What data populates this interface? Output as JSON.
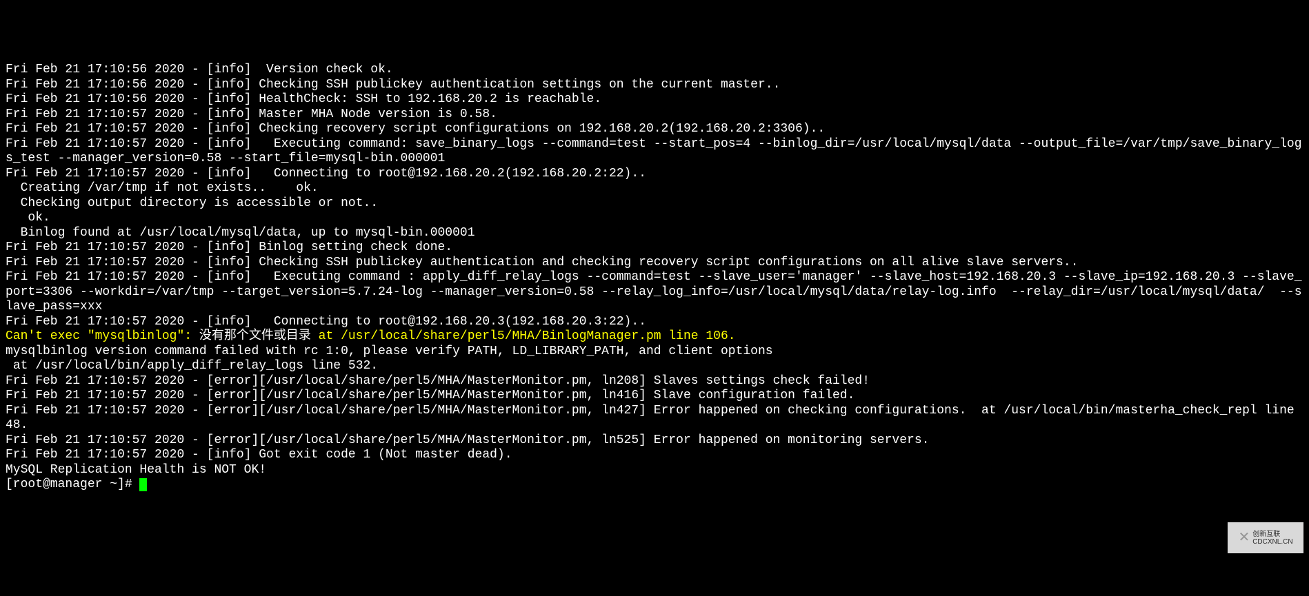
{
  "lines": [
    {
      "segments": [
        {
          "text": "Fri Feb 21 17:10:56 2020 - [info]  Version check ok."
        }
      ]
    },
    {
      "segments": [
        {
          "text": "Fri Feb 21 17:10:56 2020 - [info] Checking SSH publickey authentication settings on the current master.."
        }
      ]
    },
    {
      "segments": [
        {
          "text": "Fri Feb 21 17:10:56 2020 - [info] HealthCheck: SSH to 192.168.20.2 is reachable."
        }
      ]
    },
    {
      "segments": [
        {
          "text": "Fri Feb 21 17:10:57 2020 - [info] Master MHA Node version is 0.58."
        }
      ]
    },
    {
      "segments": [
        {
          "text": "Fri Feb 21 17:10:57 2020 - [info] Checking recovery script configurations on 192.168.20.2(192.168.20.2:3306).."
        }
      ]
    },
    {
      "segments": [
        {
          "text": "Fri Feb 21 17:10:57 2020 - [info]   Executing command: save_binary_logs --command=test --start_pos=4 --binlog_dir=/usr/local/mysql/data --output_file=/var/tmp/save_binary_logs_test --manager_version=0.58 --start_file=mysql-bin.000001"
        }
      ]
    },
    {
      "segments": [
        {
          "text": "Fri Feb 21 17:10:57 2020 - [info]   Connecting to root@192.168.20.2(192.168.20.2:22).."
        }
      ]
    },
    {
      "segments": [
        {
          "text": "  Creating /var/tmp if not exists..    ok."
        }
      ]
    },
    {
      "segments": [
        {
          "text": "  Checking output directory is accessible or not.."
        }
      ]
    },
    {
      "segments": [
        {
          "text": "   ok."
        }
      ]
    },
    {
      "segments": [
        {
          "text": "  Binlog found at /usr/local/mysql/data, up to mysql-bin.000001"
        }
      ]
    },
    {
      "segments": [
        {
          "text": "Fri Feb 21 17:10:57 2020 - [info] Binlog setting check done."
        }
      ]
    },
    {
      "segments": [
        {
          "text": "Fri Feb 21 17:10:57 2020 - [info] Checking SSH publickey authentication and checking recovery script configurations on all alive slave servers.."
        }
      ]
    },
    {
      "segments": [
        {
          "text": "Fri Feb 21 17:10:57 2020 - [info]   Executing command : apply_diff_relay_logs --command=test --slave_user='manager' --slave_host=192.168.20.3 --slave_ip=192.168.20.3 --slave_port=3306 --workdir=/var/tmp --target_version=5.7.24-log --manager_version=0.58 --relay_log_info=/usr/local/mysql/data/relay-log.info  --relay_dir=/usr/local/mysql/data/  --slave_pass=xxx"
        }
      ]
    },
    {
      "segments": [
        {
          "text": "Fri Feb 21 17:10:57 2020 - [info]   Connecting to root@192.168.20.3(192.168.20.3:22).."
        }
      ]
    },
    {
      "segments": [
        {
          "text": "Can't exec \"mysqlbinlog\": ",
          "class": "yellow"
        },
        {
          "text": "没有那个文件或目录",
          "class": "white"
        },
        {
          "text": " at /usr/local/share/perl5/MHA/BinlogManager.pm line 106.",
          "class": "yellow"
        }
      ]
    },
    {
      "segments": [
        {
          "text": "mysqlbinlog version command failed with rc 1:0, please verify PATH, LD_LIBRARY_PATH, and client options"
        }
      ]
    },
    {
      "segments": [
        {
          "text": " at /usr/local/bin/apply_diff_relay_logs line 532."
        }
      ]
    },
    {
      "segments": [
        {
          "text": "Fri Feb 21 17:10:57 2020 - [error][/usr/local/share/perl5/MHA/MasterMonitor.pm, ln208] Slaves settings check failed!"
        }
      ]
    },
    {
      "segments": [
        {
          "text": "Fri Feb 21 17:10:57 2020 - [error][/usr/local/share/perl5/MHA/MasterMonitor.pm, ln416] Slave configuration failed."
        }
      ]
    },
    {
      "segments": [
        {
          "text": "Fri Feb 21 17:10:57 2020 - [error][/usr/local/share/perl5/MHA/MasterMonitor.pm, ln427] Error happened on checking configurations.  at /usr/local/bin/masterha_check_repl line 48."
        }
      ]
    },
    {
      "segments": [
        {
          "text": "Fri Feb 21 17:10:57 2020 - [error][/usr/local/share/perl5/MHA/MasterMonitor.pm, ln525] Error happened on monitoring servers."
        }
      ]
    },
    {
      "segments": [
        {
          "text": "Fri Feb 21 17:10:57 2020 - [info] Got exit code 1 (Not master dead)."
        }
      ]
    },
    {
      "segments": [
        {
          "text": ""
        }
      ]
    },
    {
      "segments": [
        {
          "text": "MySQL Replication Health is NOT OK!"
        }
      ]
    }
  ],
  "prompt": "[root@manager ~]# ",
  "logo": {
    "brand1": "创新互联",
    "brand2": "CDCXNL.CN"
  }
}
